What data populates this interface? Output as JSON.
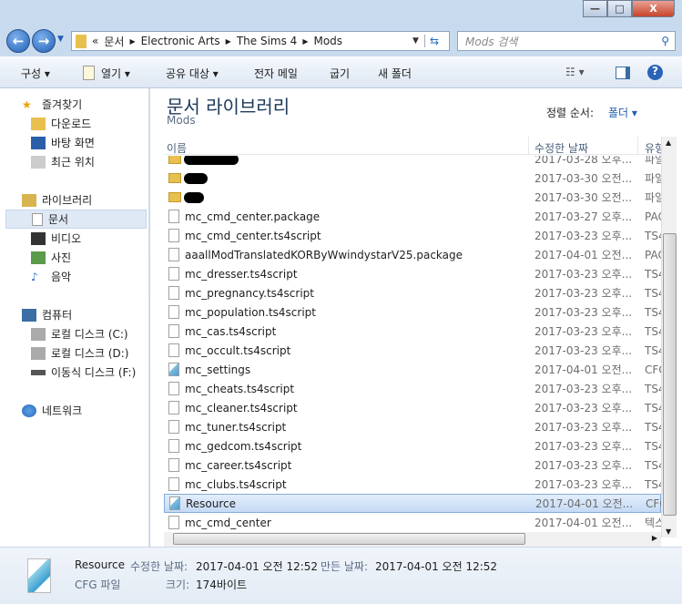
{
  "window": {
    "min": "—",
    "max": "□",
    "close": "X"
  },
  "address": {
    "overflow": "«",
    "crumbs": [
      "문서",
      "Electronic Arts",
      "The Sims 4",
      "Mods"
    ],
    "search_placeholder": "Mods 검색"
  },
  "toolbar": {
    "organize": "구성 ▾",
    "open": "열기 ▾",
    "share": "공유 대상 ▾",
    "email": "전자 메일",
    "burn": "굽기",
    "new_folder": "새 폴더"
  },
  "nav": {
    "favorites": "즐겨찾기",
    "downloads": "다운로드",
    "desktop": "바탕 화면",
    "recent": "최근 위치",
    "libraries": "라이브러리",
    "documents": "문서",
    "videos": "비디오",
    "pictures": "사진",
    "music": "음악",
    "computer": "컴퓨터",
    "disk_c": "로컬 디스크 (C:)",
    "disk_d": "로컬 디스크 (D:)",
    "disk_f": "이동식 디스크 (F:)",
    "network": "네트워크"
  },
  "library": {
    "title": "문서 라이브러리",
    "subtitle": "Mods",
    "sort_label": "정렬 순서:",
    "sort_value": "폴더 ▾"
  },
  "columns": {
    "name": "이름",
    "date": "수정한 날짜",
    "type": "유형"
  },
  "files": [
    {
      "name": "",
      "date": "2017-03-28 오후...",
      "type": "파일",
      "icon": "folder",
      "redacted": 60
    },
    {
      "name": "",
      "date": "2017-03-30 오전...",
      "type": "파일",
      "icon": "folder",
      "redacted": 26
    },
    {
      "name": "",
      "date": "2017-03-30 오전...",
      "type": "파일",
      "icon": "folder",
      "redacted": 22
    },
    {
      "name": "mc_cmd_center.package",
      "date": "2017-03-27 오후...",
      "type": "PAC",
      "icon": "file"
    },
    {
      "name": "mc_cmd_center.ts4script",
      "date": "2017-03-23 오후...",
      "type": "TS4",
      "icon": "file"
    },
    {
      "name": "aaallModTranslatedKORByWwindystarV25.package",
      "date": "2017-04-01 오전...",
      "type": "PAC",
      "icon": "file"
    },
    {
      "name": "mc_dresser.ts4script",
      "date": "2017-03-23 오후...",
      "type": "TS4",
      "icon": "file"
    },
    {
      "name": "mc_pregnancy.ts4script",
      "date": "2017-03-23 오후...",
      "type": "TS4",
      "icon": "file"
    },
    {
      "name": "mc_population.ts4script",
      "date": "2017-03-23 오후...",
      "type": "TS4",
      "icon": "file"
    },
    {
      "name": "mc_cas.ts4script",
      "date": "2017-03-23 오후...",
      "type": "TS4",
      "icon": "file"
    },
    {
      "name": "mc_occult.ts4script",
      "date": "2017-03-23 오후...",
      "type": "TS4",
      "icon": "file"
    },
    {
      "name": "mc_settings",
      "date": "2017-04-01 오전...",
      "type": "CFG",
      "icon": "cfg"
    },
    {
      "name": "mc_cheats.ts4script",
      "date": "2017-03-23 오후...",
      "type": "TS4",
      "icon": "file"
    },
    {
      "name": "mc_cleaner.ts4script",
      "date": "2017-03-23 오후...",
      "type": "TS4",
      "icon": "file"
    },
    {
      "name": "mc_tuner.ts4script",
      "date": "2017-03-23 오후...",
      "type": "TS4",
      "icon": "file"
    },
    {
      "name": "mc_gedcom.ts4script",
      "date": "2017-03-23 오후...",
      "type": "TS4",
      "icon": "file"
    },
    {
      "name": "mc_career.ts4script",
      "date": "2017-03-23 오후...",
      "type": "TS4",
      "icon": "file"
    },
    {
      "name": "mc_clubs.ts4script",
      "date": "2017-03-23 오후...",
      "type": "TS4",
      "icon": "file"
    },
    {
      "name": "Resource",
      "date": "2017-04-01 오전...",
      "type": "CFG",
      "icon": "cfg",
      "selected": true
    },
    {
      "name": "mc_cmd_center",
      "date": "2017-04-01 오전...",
      "type": "텍스",
      "icon": "file"
    }
  ],
  "status": {
    "name": "Resource",
    "type": "CFG 파일",
    "modified_label": "수정한 날짜:",
    "modified": "2017-04-01 오전 12:52",
    "created_label": "만든 날짜:",
    "created": "2017-04-01 오전 12:52",
    "size_label": "크기:",
    "size": "174바이트"
  }
}
